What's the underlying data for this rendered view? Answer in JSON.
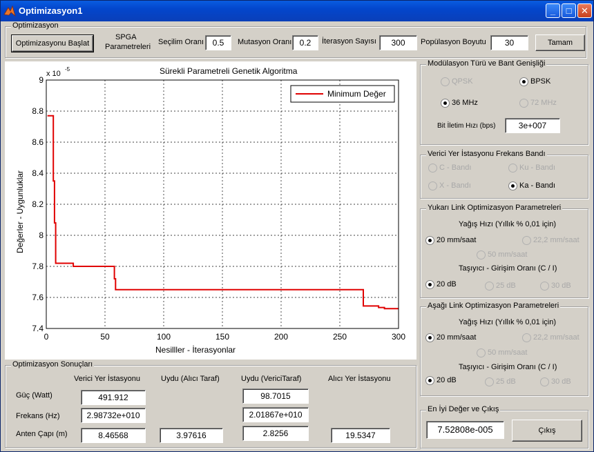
{
  "window": {
    "title": "Optimizasyon1",
    "buttons": {
      "minimize": "_",
      "maximize": "□",
      "close": "✕"
    }
  },
  "optim": {
    "group_title": "Optimizasyon",
    "start_button": "Optimizasyonu Başlat",
    "spga_label_1": "SPGA",
    "spga_label_2": "Parametreleri",
    "selection_rate_label": "Seçilim Oranı",
    "selection_rate_value": "0.5",
    "mutation_rate_label": "Mutasyon Oranı",
    "mutation_rate_value": "0.2",
    "iteration_label": "İterasyon Sayısı",
    "iteration_value": "300",
    "population_label": "Popülasyon Boyutu",
    "population_value": "30",
    "ok_button": "Tamam"
  },
  "modulation": {
    "group_title": "Modülasyon Türü ve Bant Genişliği",
    "qpsk": "QPSK",
    "bpsk": "BPSK",
    "mhz36": "36 MHz",
    "mhz72": "72 MHz",
    "bitrate_label": "Bit İletim Hızı (bps)",
    "bitrate_value": "3e+007"
  },
  "freqband": {
    "group_title": "Verici Yer İstasyonu Frekans Bandı",
    "c": "C - Bandı",
    "ku": "Ku - Bandı",
    "x": "X - Bandı",
    "ka": "Ka - Bandı"
  },
  "uplink": {
    "group_title": "Yukarı Link Optimizasyon Parametreleri",
    "rain_title": "Yağış Hızı (Yıllık % 0,01 için)",
    "r20": "20 mm/saat",
    "r22": "22,2 mm/saat",
    "r50": "50 mm/saat",
    "ci_title": "Taşıyıcı - Girişim Oranı (C / I)",
    "db20": "20 dB",
    "db25": "25 dB",
    "db30": "30 dB"
  },
  "downlink": {
    "group_title": "Aşağı Link Optimizasyon Parametreleri",
    "rain_title": "Yağış Hızı (Yıllık % 0,01 için)",
    "r20": "20 mm/saat",
    "r22": "22,2 mm/saat",
    "r50": "50 mm/saat",
    "ci_title": "Taşıyıcı - Girişim Oranı (C / I)",
    "db20": "20 dB",
    "db25": "25 dB",
    "db30": "30 dB"
  },
  "best": {
    "group_title": "En İyi Değer ve Çıkış",
    "value": "7.52808e-005",
    "exit_button": "Çıkış"
  },
  "results": {
    "group_title": "Optimizasyon Sonuçları",
    "col1": "Verici Yer İstasyonu",
    "col2": "Uydu (Alıcı Taraf)",
    "col3": "Uydu (VericiTaraf)",
    "col4": "Alıcı Yer İstasyonu",
    "row1": "Güç (Watt)",
    "row2": "Frekans (Hz)",
    "row3": "Anten Çapı (m)",
    "power_tx": "491.912",
    "power_sat_tx": "98.7015",
    "freq_tx": "2.98732e+010",
    "freq_sat_tx": "2.01867e+010",
    "ant_tx": "8.46568",
    "ant_sat_rx": "3.97616",
    "ant_sat_tx": "2.8256",
    "ant_rx": "19.5347"
  },
  "chart_data": {
    "type": "line",
    "title": "Sürekli Parametreli Genetik Algoritma",
    "xlabel": "Nesilller - İterasyonlar",
    "ylabel": "Değerler - Uygunluklar",
    "exponent_label": "x 10",
    "exponent_power": "-5",
    "xlim": [
      0,
      300
    ],
    "ylim": [
      7.4,
      9.0
    ],
    "xticks": [
      0,
      50,
      100,
      150,
      200,
      250,
      300
    ],
    "yticks": [
      7.4,
      7.6,
      7.8,
      8.0,
      8.2,
      8.4,
      8.6,
      8.8,
      9.0
    ],
    "xtick_labels": [
      "0",
      "50",
      "100",
      "150",
      "200",
      "250",
      "300"
    ],
    "ytick_labels": [
      "7.4",
      "7.6",
      "7.8",
      "8",
      "8.2",
      "8.4",
      "8.6",
      "8.8",
      "9"
    ],
    "grid": true,
    "legend_position": "top-right",
    "series_color": "#e00000",
    "series": [
      {
        "name": "Minimum Değer",
        "x": [
          1,
          6,
          6,
          7,
          7,
          8,
          8,
          23,
          23,
          58,
          58,
          59,
          59,
          270,
          270,
          283,
          283,
          288,
          288,
          300
        ],
        "y": [
          8.77,
          8.77,
          8.35,
          8.35,
          8.08,
          8.08,
          7.82,
          7.82,
          7.8,
          7.8,
          7.72,
          7.72,
          7.65,
          7.65,
          7.545,
          7.545,
          7.535,
          7.535,
          7.528,
          7.528
        ]
      }
    ]
  }
}
